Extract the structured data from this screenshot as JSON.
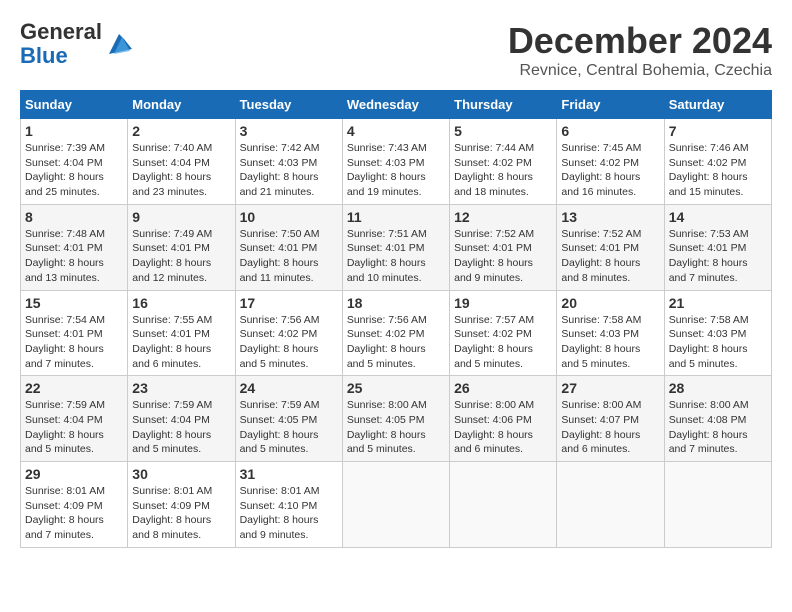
{
  "logo": {
    "general": "General",
    "blue": "Blue"
  },
  "header": {
    "month": "December 2024",
    "location": "Revnice, Central Bohemia, Czechia"
  },
  "days_of_week": [
    "Sunday",
    "Monday",
    "Tuesday",
    "Wednesday",
    "Thursday",
    "Friday",
    "Saturday"
  ],
  "weeks": [
    [
      {
        "day": "1",
        "info": "Sunrise: 7:39 AM\nSunset: 4:04 PM\nDaylight: 8 hours and 25 minutes."
      },
      {
        "day": "2",
        "info": "Sunrise: 7:40 AM\nSunset: 4:04 PM\nDaylight: 8 hours and 23 minutes."
      },
      {
        "day": "3",
        "info": "Sunrise: 7:42 AM\nSunset: 4:03 PM\nDaylight: 8 hours and 21 minutes."
      },
      {
        "day": "4",
        "info": "Sunrise: 7:43 AM\nSunset: 4:03 PM\nDaylight: 8 hours and 19 minutes."
      },
      {
        "day": "5",
        "info": "Sunrise: 7:44 AM\nSunset: 4:02 PM\nDaylight: 8 hours and 18 minutes."
      },
      {
        "day": "6",
        "info": "Sunrise: 7:45 AM\nSunset: 4:02 PM\nDaylight: 8 hours and 16 minutes."
      },
      {
        "day": "7",
        "info": "Sunrise: 7:46 AM\nSunset: 4:02 PM\nDaylight: 8 hours and 15 minutes."
      }
    ],
    [
      {
        "day": "8",
        "info": "Sunrise: 7:48 AM\nSunset: 4:01 PM\nDaylight: 8 hours and 13 minutes."
      },
      {
        "day": "9",
        "info": "Sunrise: 7:49 AM\nSunset: 4:01 PM\nDaylight: 8 hours and 12 minutes."
      },
      {
        "day": "10",
        "info": "Sunrise: 7:50 AM\nSunset: 4:01 PM\nDaylight: 8 hours and 11 minutes."
      },
      {
        "day": "11",
        "info": "Sunrise: 7:51 AM\nSunset: 4:01 PM\nDaylight: 8 hours and 10 minutes."
      },
      {
        "day": "12",
        "info": "Sunrise: 7:52 AM\nSunset: 4:01 PM\nDaylight: 8 hours and 9 minutes."
      },
      {
        "day": "13",
        "info": "Sunrise: 7:52 AM\nSunset: 4:01 PM\nDaylight: 8 hours and 8 minutes."
      },
      {
        "day": "14",
        "info": "Sunrise: 7:53 AM\nSunset: 4:01 PM\nDaylight: 8 hours and 7 minutes."
      }
    ],
    [
      {
        "day": "15",
        "info": "Sunrise: 7:54 AM\nSunset: 4:01 PM\nDaylight: 8 hours and 7 minutes."
      },
      {
        "day": "16",
        "info": "Sunrise: 7:55 AM\nSunset: 4:01 PM\nDaylight: 8 hours and 6 minutes."
      },
      {
        "day": "17",
        "info": "Sunrise: 7:56 AM\nSunset: 4:02 PM\nDaylight: 8 hours and 5 minutes."
      },
      {
        "day": "18",
        "info": "Sunrise: 7:56 AM\nSunset: 4:02 PM\nDaylight: 8 hours and 5 minutes."
      },
      {
        "day": "19",
        "info": "Sunrise: 7:57 AM\nSunset: 4:02 PM\nDaylight: 8 hours and 5 minutes."
      },
      {
        "day": "20",
        "info": "Sunrise: 7:58 AM\nSunset: 4:03 PM\nDaylight: 8 hours and 5 minutes."
      },
      {
        "day": "21",
        "info": "Sunrise: 7:58 AM\nSunset: 4:03 PM\nDaylight: 8 hours and 5 minutes."
      }
    ],
    [
      {
        "day": "22",
        "info": "Sunrise: 7:59 AM\nSunset: 4:04 PM\nDaylight: 8 hours and 5 minutes."
      },
      {
        "day": "23",
        "info": "Sunrise: 7:59 AM\nSunset: 4:04 PM\nDaylight: 8 hours and 5 minutes."
      },
      {
        "day": "24",
        "info": "Sunrise: 7:59 AM\nSunset: 4:05 PM\nDaylight: 8 hours and 5 minutes."
      },
      {
        "day": "25",
        "info": "Sunrise: 8:00 AM\nSunset: 4:05 PM\nDaylight: 8 hours and 5 minutes."
      },
      {
        "day": "26",
        "info": "Sunrise: 8:00 AM\nSunset: 4:06 PM\nDaylight: 8 hours and 6 minutes."
      },
      {
        "day": "27",
        "info": "Sunrise: 8:00 AM\nSunset: 4:07 PM\nDaylight: 8 hours and 6 minutes."
      },
      {
        "day": "28",
        "info": "Sunrise: 8:00 AM\nSunset: 4:08 PM\nDaylight: 8 hours and 7 minutes."
      }
    ],
    [
      {
        "day": "29",
        "info": "Sunrise: 8:01 AM\nSunset: 4:09 PM\nDaylight: 8 hours and 7 minutes."
      },
      {
        "day": "30",
        "info": "Sunrise: 8:01 AM\nSunset: 4:09 PM\nDaylight: 8 hours and 8 minutes."
      },
      {
        "day": "31",
        "info": "Sunrise: 8:01 AM\nSunset: 4:10 PM\nDaylight: 8 hours and 9 minutes."
      },
      {
        "day": "",
        "info": ""
      },
      {
        "day": "",
        "info": ""
      },
      {
        "day": "",
        "info": ""
      },
      {
        "day": "",
        "info": ""
      }
    ]
  ]
}
